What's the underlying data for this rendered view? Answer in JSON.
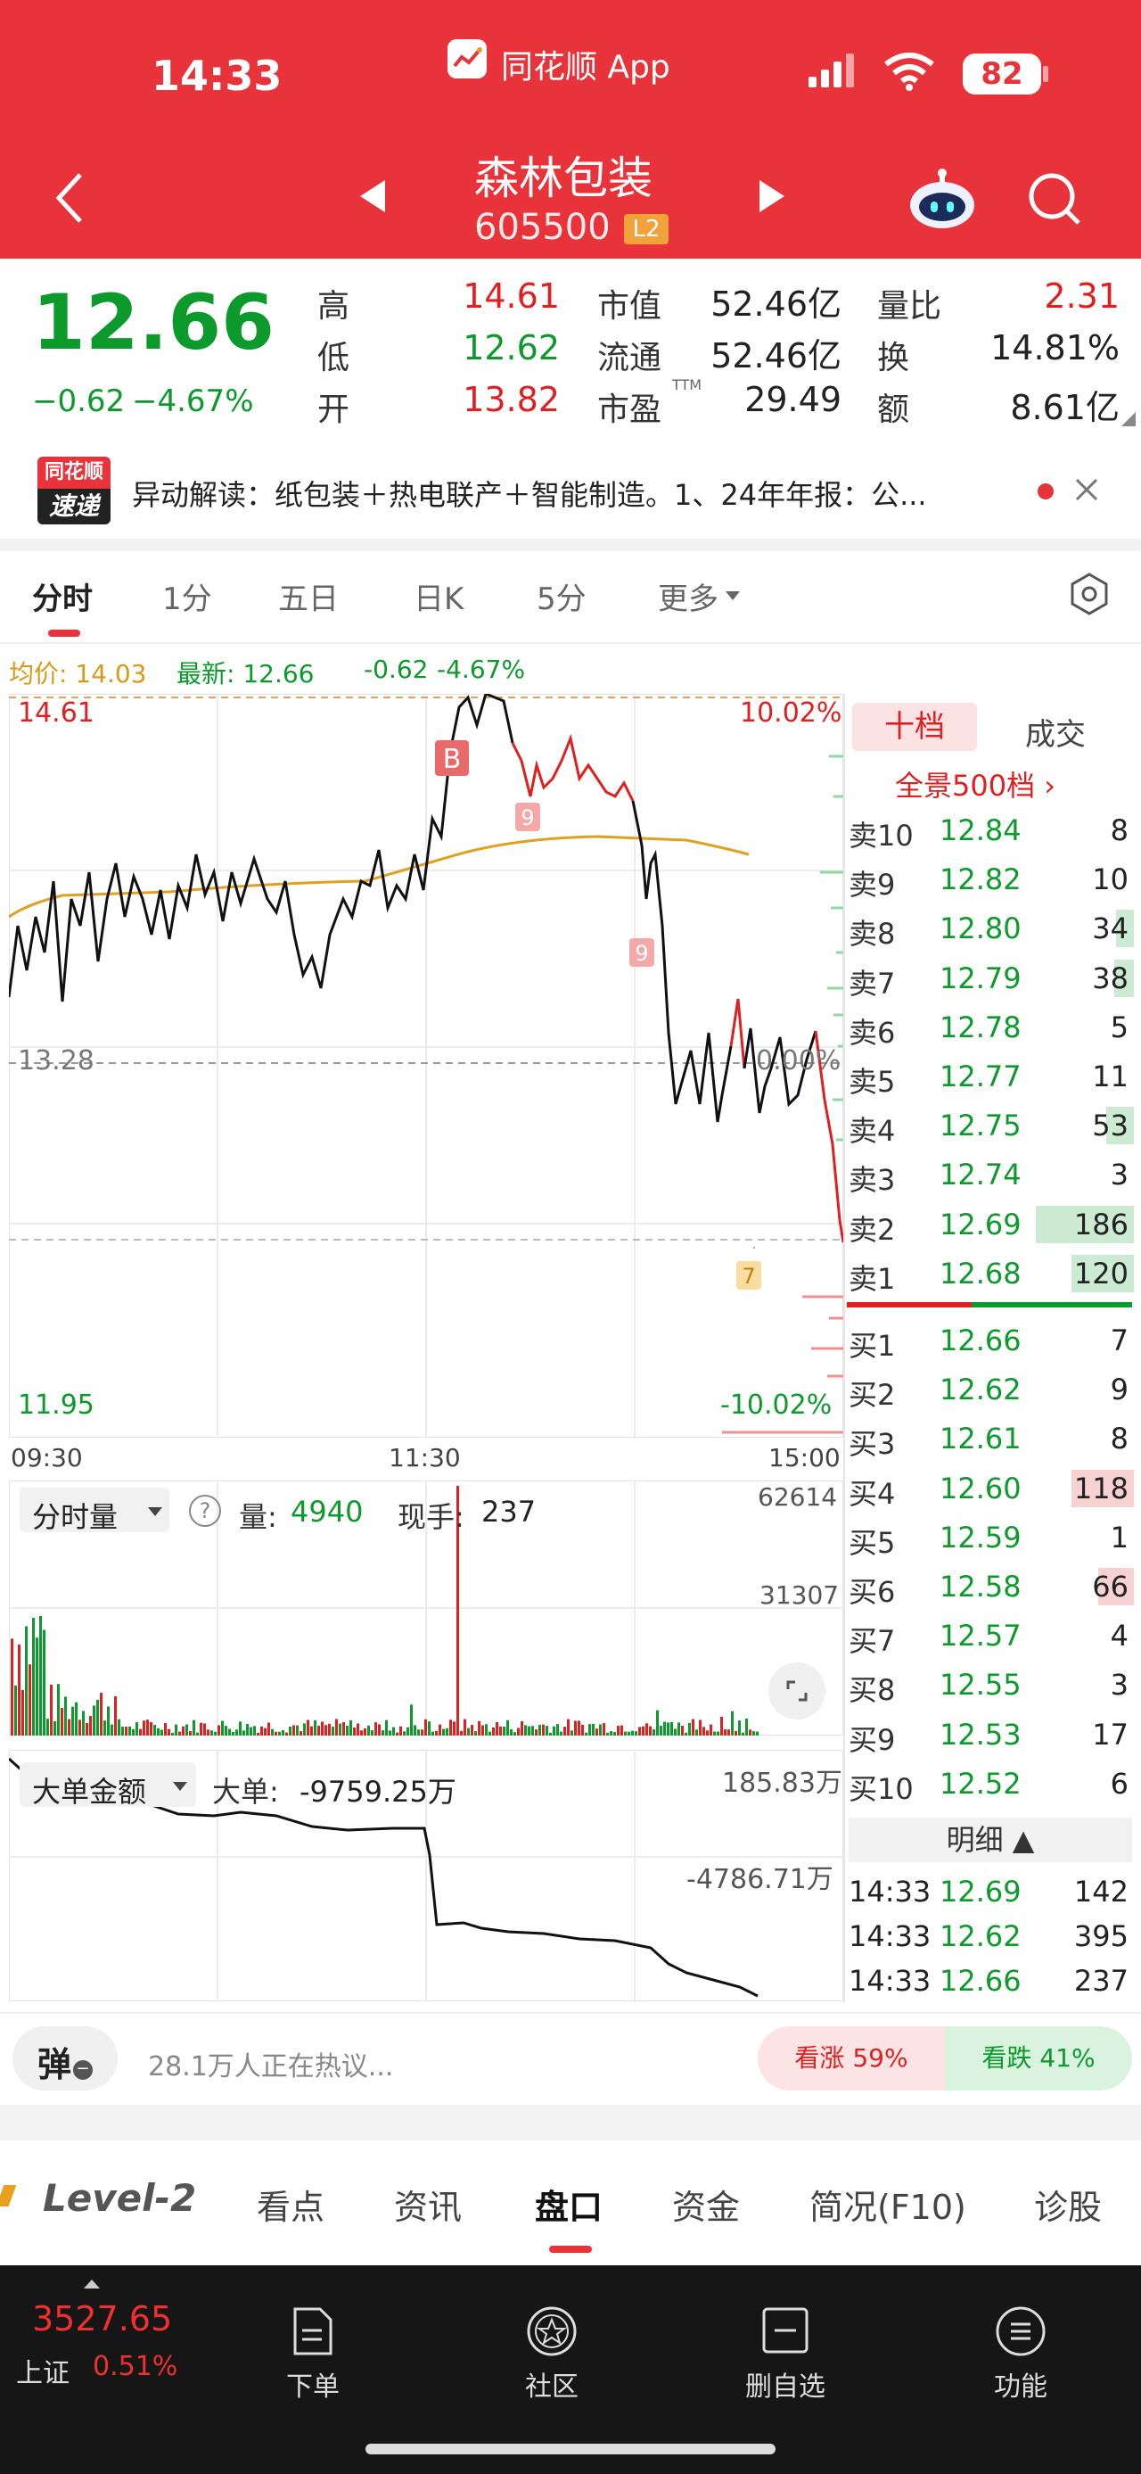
{
  "status_bar": {
    "time": "14:33",
    "app": "同花顺 App",
    "battery": "82"
  },
  "header": {
    "stock_name": "森林包装",
    "stock_code": "605500",
    "level": "L2"
  },
  "quote": {
    "price": "12.66",
    "change": "−0.62",
    "change_pct": "−4.67%",
    "high_label": "高",
    "high": "14.61",
    "low_label": "低",
    "low": "12.62",
    "open_label": "开",
    "open": "13.82",
    "mcap_label": "市值",
    "mcap": "52.46亿",
    "float_label": "流通",
    "float": "52.46亿",
    "pe_label": "市盈",
    "pe_sup": "TTM",
    "pe": "29.49",
    "vr_label": "量比",
    "vr": "2.31",
    "turnover_label": "换",
    "turnover": "14.81%",
    "amount_label": "额",
    "amount": "8.61亿"
  },
  "news": {
    "badge_top": "同花顺",
    "badge_bottom": "速递",
    "text": "异动解读：纸包装＋热电联产＋智能制造。1、24年年报：公..."
  },
  "tabs": [
    "分时",
    "1分",
    "五日",
    "日K",
    "5分",
    "更多"
  ],
  "tab_active": 0,
  "chart_header": {
    "avg_label": "均价: 14.03",
    "latest_label": "最新: 12.66",
    "chg": "-0.62",
    "chg_pct": "-4.67%"
  },
  "chart_labels": {
    "top_left": "14.61",
    "top_right": "10.02%",
    "mid_left": "13.28",
    "mid_right": "0.00%",
    "bot_left": "11.95",
    "bot_right": "-10.02%",
    "t_start": "09:30",
    "t_mid": "11:30",
    "t_end": "15:00",
    "marker_b": "B",
    "marker_9a": "9",
    "marker_9b": "9",
    "marker_7": "7"
  },
  "volume": {
    "selector": "分时量",
    "help": "?",
    "vol_label": "量:",
    "vol": "4940",
    "hand_label": "现手:",
    "hand": "237",
    "ymax": "62614",
    "ymid": "31307"
  },
  "bigorder": {
    "selector": "大单金额",
    "label": "大单:",
    "value": "-9759.25万",
    "ymax": "185.83万",
    "ymid": "-4786.71万"
  },
  "book": {
    "tab1": "十档",
    "tab2": "成交",
    "panorama": "全景500档 ›",
    "sells": [
      {
        "label": "卖10",
        "price": "12.84",
        "vol": "8",
        "bar": 0
      },
      {
        "label": "卖9",
        "price": "12.82",
        "vol": "10",
        "bar": 0
      },
      {
        "label": "卖8",
        "price": "12.80",
        "vol": "34",
        "bar": 0.18
      },
      {
        "label": "卖7",
        "price": "12.79",
        "vol": "38",
        "bar": 0.2
      },
      {
        "label": "卖6",
        "price": "12.78",
        "vol": "5",
        "bar": 0
      },
      {
        "label": "卖5",
        "price": "12.77",
        "vol": "11",
        "bar": 0
      },
      {
        "label": "卖4",
        "price": "12.75",
        "vol": "53",
        "bar": 0.28
      },
      {
        "label": "卖3",
        "price": "12.74",
        "vol": "3",
        "bar": 0
      },
      {
        "label": "卖2",
        "price": "12.69",
        "vol": "186",
        "bar": 1
      },
      {
        "label": "卖1",
        "price": "12.68",
        "vol": "120",
        "bar": 0.64
      }
    ],
    "buys": [
      {
        "label": "买1",
        "price": "12.66",
        "vol": "7",
        "bar": 0
      },
      {
        "label": "买2",
        "price": "12.62",
        "vol": "9",
        "bar": 0
      },
      {
        "label": "买3",
        "price": "12.61",
        "vol": "8",
        "bar": 0
      },
      {
        "label": "买4",
        "price": "12.60",
        "vol": "118",
        "bar": 0.64
      },
      {
        "label": "买5",
        "price": "12.59",
        "vol": "1",
        "bar": 0
      },
      {
        "label": "买6",
        "price": "12.58",
        "vol": "66",
        "bar": 0.36
      },
      {
        "label": "买7",
        "price": "12.57",
        "vol": "4",
        "bar": 0
      },
      {
        "label": "买8",
        "price": "12.55",
        "vol": "3",
        "bar": 0
      },
      {
        "label": "买9",
        "price": "12.53",
        "vol": "17",
        "bar": 0
      },
      {
        "label": "买10",
        "price": "12.52",
        "vol": "6",
        "bar": 0
      }
    ],
    "detail_label": "明细 ▲",
    "trades": [
      {
        "time": "14:33",
        "price": "12.69",
        "vol": "142"
      },
      {
        "time": "14:33",
        "price": "12.62",
        "vol": "395"
      },
      {
        "time": "14:33",
        "price": "12.66",
        "vol": "237"
      }
    ]
  },
  "discussion": {
    "barrage": "弹",
    "text": "28.1万人正在热议...",
    "bull": "看涨 59%",
    "bear": "看跌 41%"
  },
  "sub_tabs": [
    "Level-2",
    "看点",
    "资讯",
    "盘口",
    "资金",
    "简况(F10)",
    "诊股"
  ],
  "sub_tab_active": 3,
  "bottom_nav": {
    "index_value": "3527.65",
    "index_name": "上证",
    "index_pct": "0.51%",
    "items": [
      "下单",
      "社区",
      "删自选",
      "功能"
    ]
  },
  "colors": {
    "header_red": "#e8333a",
    "up": "#e02020",
    "down": "#0c9a2c",
    "avg_line": "#e0a020"
  }
}
